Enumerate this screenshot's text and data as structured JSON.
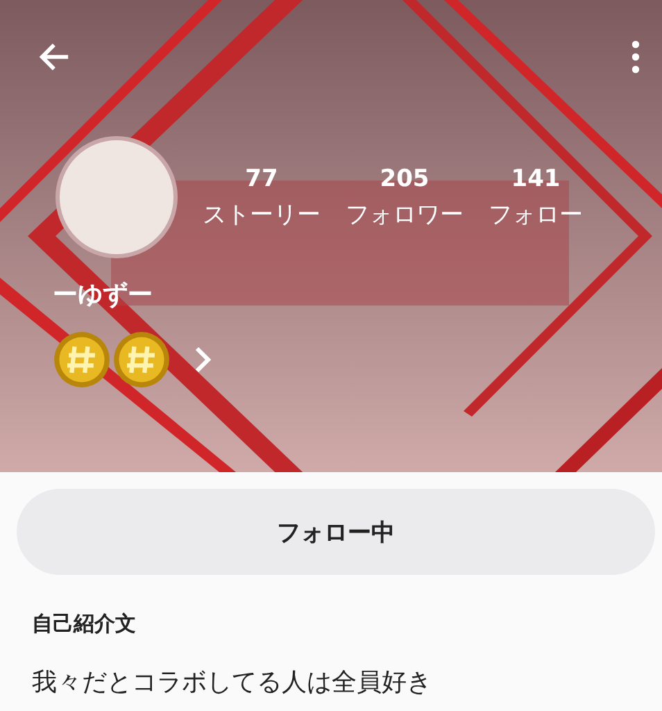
{
  "header": {
    "stats": [
      {
        "value": "77",
        "label": "ストーリー"
      },
      {
        "value": "205",
        "label": "フォロワー"
      },
      {
        "value": "141",
        "label": "フォロー"
      }
    ],
    "username": "ーゆずー",
    "badges": [
      {
        "kind": "coin"
      },
      {
        "kind": "coin"
      }
    ]
  },
  "follow_button": {
    "label": "フォロー中"
  },
  "bio": {
    "heading": "自己紹介文",
    "text": "我々だとコラボしてる人は全員好き"
  }
}
